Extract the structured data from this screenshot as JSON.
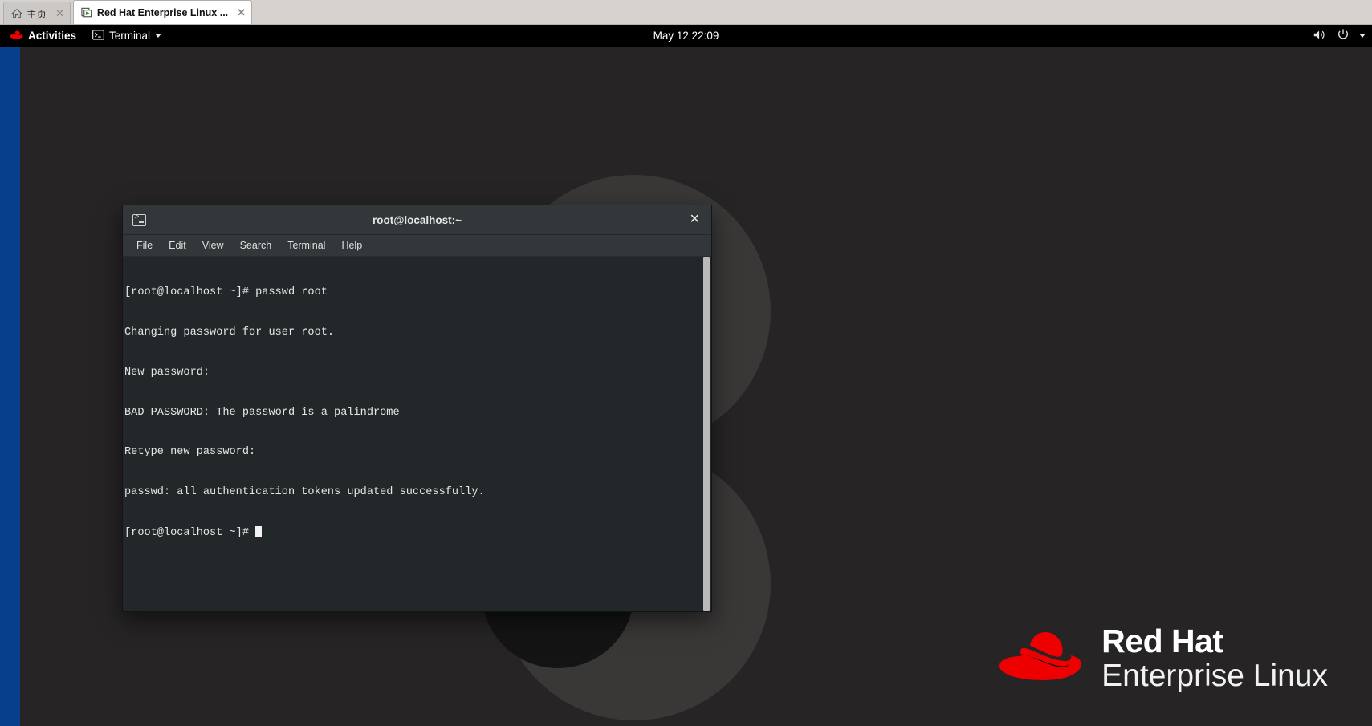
{
  "browser": {
    "tabs": [
      {
        "label": "主页",
        "icon": "home-icon",
        "close": "✕",
        "active": false
      },
      {
        "label": "Red Hat Enterprise Linux ...",
        "icon": "vm-play-icon",
        "close": "✕",
        "active": true
      }
    ]
  },
  "topbar": {
    "activities": "Activities",
    "app_menu": "Terminal",
    "clock": "May 12  22:09",
    "indicators": [
      "volume-icon",
      "power-icon",
      "chevron-down-icon"
    ]
  },
  "terminal": {
    "title": "root@localhost:~",
    "close_label": "✕",
    "menus": [
      "File",
      "Edit",
      "View",
      "Search",
      "Terminal",
      "Help"
    ],
    "lines": [
      "[root@localhost ~]# passwd root",
      "Changing password for user root.",
      "New password:",
      "BAD PASSWORD: The password is a palindrome",
      "Retype new password:",
      "passwd: all authentication tokens updated successfully.",
      "[root@localhost ~]# "
    ]
  },
  "desktop": {
    "brand_line1": "Red Hat",
    "brand_line2": "Enterprise Linux",
    "accent_blue": "#073f8c",
    "brand_red": "#ee0000",
    "background": "#262424"
  }
}
